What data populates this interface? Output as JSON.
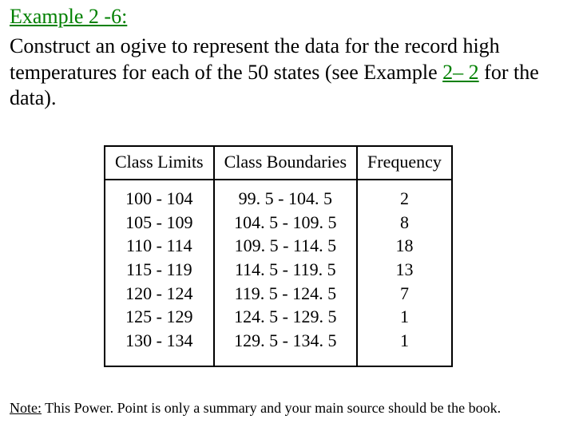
{
  "title": "Example 2 -6:",
  "body": {
    "part1": "Construct an ogive to represent the data for the record high temperatures for each of the 50 states (see Example ",
    "link": "2– 2",
    "part2": " for the data)."
  },
  "table": {
    "headers": [
      "Class Limits",
      "Class Boundaries",
      "Frequency"
    ],
    "rows": [
      {
        "limits": "100 - 104",
        "boundaries": "99. 5 - 104. 5",
        "freq": "2"
      },
      {
        "limits": "105 - 109",
        "boundaries": "104. 5 - 109. 5",
        "freq": "8"
      },
      {
        "limits": "110 - 114",
        "boundaries": "109. 5 - 114. 5",
        "freq": "18"
      },
      {
        "limits": "115 - 119",
        "boundaries": "114. 5 - 119. 5",
        "freq": "13"
      },
      {
        "limits": "120 - 124",
        "boundaries": "119. 5 - 124. 5",
        "freq": "7"
      },
      {
        "limits": "125 - 129",
        "boundaries": "124. 5 - 129. 5",
        "freq": "1"
      },
      {
        "limits": "130 - 134",
        "boundaries": "129. 5 - 134. 5",
        "freq": "1"
      }
    ]
  },
  "footnote": {
    "label": "Note:",
    "text": " This Power. Point is only a summary and your main source should be the book."
  },
  "chart_data": {
    "type": "table",
    "title": "Record high temperatures frequency distribution (50 states)",
    "columns": [
      "Class Limits",
      "Class Boundaries",
      "Frequency"
    ],
    "rows": [
      [
        "100 - 104",
        "99.5 - 104.5",
        2
      ],
      [
        "105 - 109",
        "104.5 - 109.5",
        8
      ],
      [
        "110 - 114",
        "109.5 - 114.5",
        18
      ],
      [
        "115 - 119",
        "114.5 - 119.5",
        13
      ],
      [
        "120 - 124",
        "119.5 - 124.5",
        7
      ],
      [
        "125 - 129",
        "124.5 - 129.5",
        1
      ],
      [
        "130 - 134",
        "129.5 - 134.5",
        1
      ]
    ]
  }
}
